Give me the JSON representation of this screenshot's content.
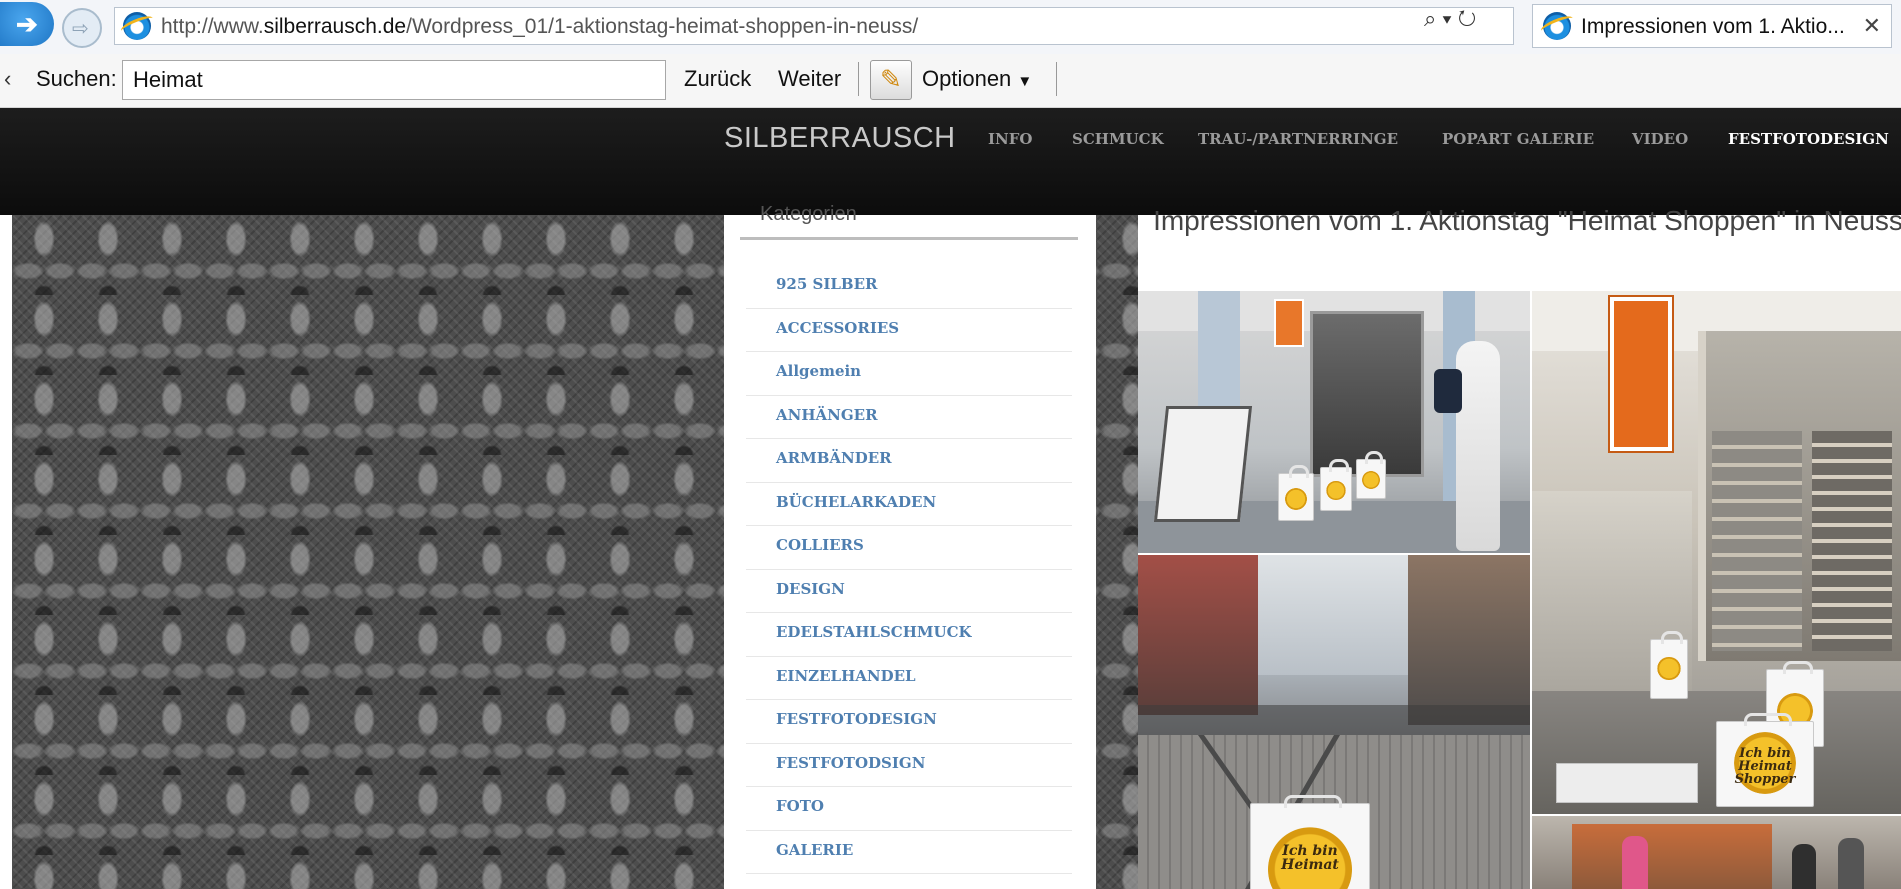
{
  "browser": {
    "url_prefix": "http://www.",
    "url_domain": "silberrausch.de",
    "url_path": "/Wordpress_01/1-aktionstag-heimat-shoppen-in-neuss/",
    "url_tools": "⌕ ▾ ↻",
    "tab_title": "Impressionen vom 1. Aktio...",
    "tab_close": "✕",
    "back_arrow": "➔",
    "forward_arrow": "⇨"
  },
  "findbar": {
    "close": "‹",
    "label": "Suchen:",
    "query": "Heimat",
    "back_label": "Zurück",
    "next_label": "Weiter",
    "options_label": "Optionen",
    "options_arrow": "▼"
  },
  "site": {
    "logo": "SILBERRAUSCH",
    "nav": [
      "INFO",
      "SCHMUCK",
      "TRAU-/PARTNERRINGE",
      "POPART GALERIE",
      "VIDEO",
      "FESTFOTODESIGN"
    ],
    "active_nav": "FESTFOTODESIGN"
  },
  "sidebar": {
    "title": "Kategorien",
    "categories": [
      "925 SILBER",
      "ACCESSORIES",
      "Allgemein",
      "ANHÄNGER",
      "ARMBÄNDER",
      "BÜCHELARKADEN",
      "COLLIERS",
      "DESIGN",
      "EDELSTAHLSCHMUCK",
      "EINZELHANDEL",
      "FESTFOTODESIGN",
      "FESTFOTODSIGN",
      "FOTO",
      "GALERIE"
    ]
  },
  "post": {
    "title": "Impressionen vom 1. Aktionstag \"Heimat Shoppen\" in Neuss",
    "bag_text_1": "Ich bin",
    "bag_text_2": "Heimat",
    "bag_text_3": "Shopper"
  },
  "colors": {
    "header_bg": "#111111",
    "category_link": "#4f7fb0",
    "nav_active": "#ffffff",
    "bag_logo": "#f4c12a"
  }
}
